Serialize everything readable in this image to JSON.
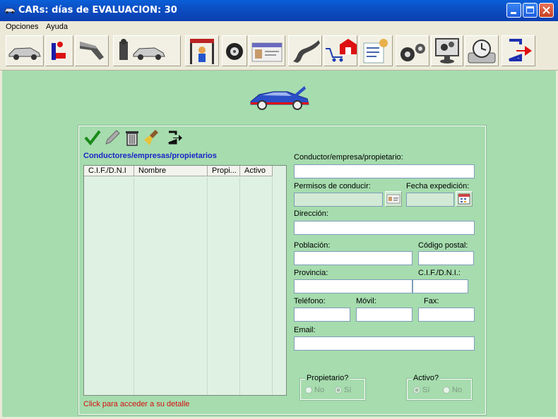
{
  "window": {
    "title": "CARs: días de EVALUACION: 30"
  },
  "menu": {
    "items": [
      "Opciones",
      "Ayuda"
    ]
  },
  "toolbar": {
    "buttons": [
      "car-icon",
      "driver-seat-icon",
      "fuel-nozzle-icon",
      "mechanic-car-icon",
      "car-lift-icon",
      "tire-icon",
      "license-card-icon",
      "road-icon",
      "cart-home-icon",
      "notes-icon",
      "gears-icon",
      "settings-monitor-icon",
      "disk-restore-icon",
      "exit-icon"
    ]
  },
  "panel": {
    "list_title": "Conductores/empresas/propietarios",
    "columns": [
      "C.I.F./D.N.I",
      "Nombre",
      "Propi...",
      "Activo"
    ],
    "hint": "Click para acceder a su detalle",
    "tools": [
      "check-icon",
      "pencil-icon",
      "trash-icon",
      "broom-icon",
      "exit-icon"
    ]
  },
  "form": {
    "conductor_label": "Conductor/empresa/propietario:",
    "permisos_label": "Permisos de conducir:",
    "fecha_label": "Fecha expedición:",
    "direccion_label": "Dirección:",
    "poblacion_label": "Población:",
    "cp_label": "Código postal:",
    "provincia_label": "Provincia:",
    "cif_label": "C.I.F./D.N.I.:",
    "telefono_label": "Teléfono:",
    "movil_label": "Móvil:",
    "fax_label": "Fax:",
    "email_label": "Email:",
    "propietario_group": "Propietario?",
    "propietario_no": "No",
    "propietario_si": "Sí",
    "activo_group": "Activo?",
    "activo_si": "Sí",
    "activo_no": "No"
  }
}
